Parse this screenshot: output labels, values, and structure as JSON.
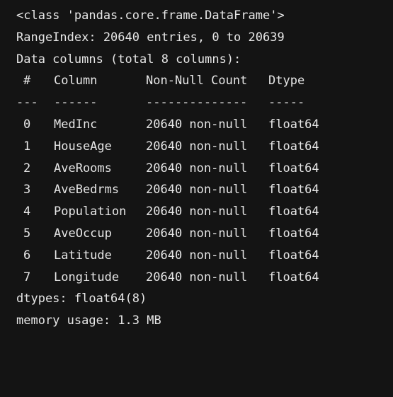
{
  "info": {
    "class_line": "<class 'pandas.core.frame.DataFrame'>",
    "range_index": "RangeIndex: 20640 entries, 0 to 20639",
    "data_columns": "Data columns (total 8 columns):",
    "header": {
      "num": "#",
      "column": "Column",
      "count": "Non-Null Count",
      "dtype": "Dtype"
    },
    "separator": {
      "num": "---",
      "column": "------",
      "count": "--------------",
      "dtype": "-----"
    },
    "rows": [
      {
        "num": "0",
        "column": "MedInc",
        "count": "20640 non-null",
        "dtype": "float64"
      },
      {
        "num": "1",
        "column": "HouseAge",
        "count": "20640 non-null",
        "dtype": "float64"
      },
      {
        "num": "2",
        "column": "AveRooms",
        "count": "20640 non-null",
        "dtype": "float64"
      },
      {
        "num": "3",
        "column": "AveBedrms",
        "count": "20640 non-null",
        "dtype": "float64"
      },
      {
        "num": "4",
        "column": "Population",
        "count": "20640 non-null",
        "dtype": "float64"
      },
      {
        "num": "5",
        "column": "AveOccup",
        "count": "20640 non-null",
        "dtype": "float64"
      },
      {
        "num": "6",
        "column": "Latitude",
        "count": "20640 non-null",
        "dtype": "float64"
      },
      {
        "num": "7",
        "column": "Longitude",
        "count": "20640 non-null",
        "dtype": "float64"
      }
    ],
    "dtypes": "dtypes: float64(8)",
    "memory": "memory usage: 1.3 MB"
  }
}
